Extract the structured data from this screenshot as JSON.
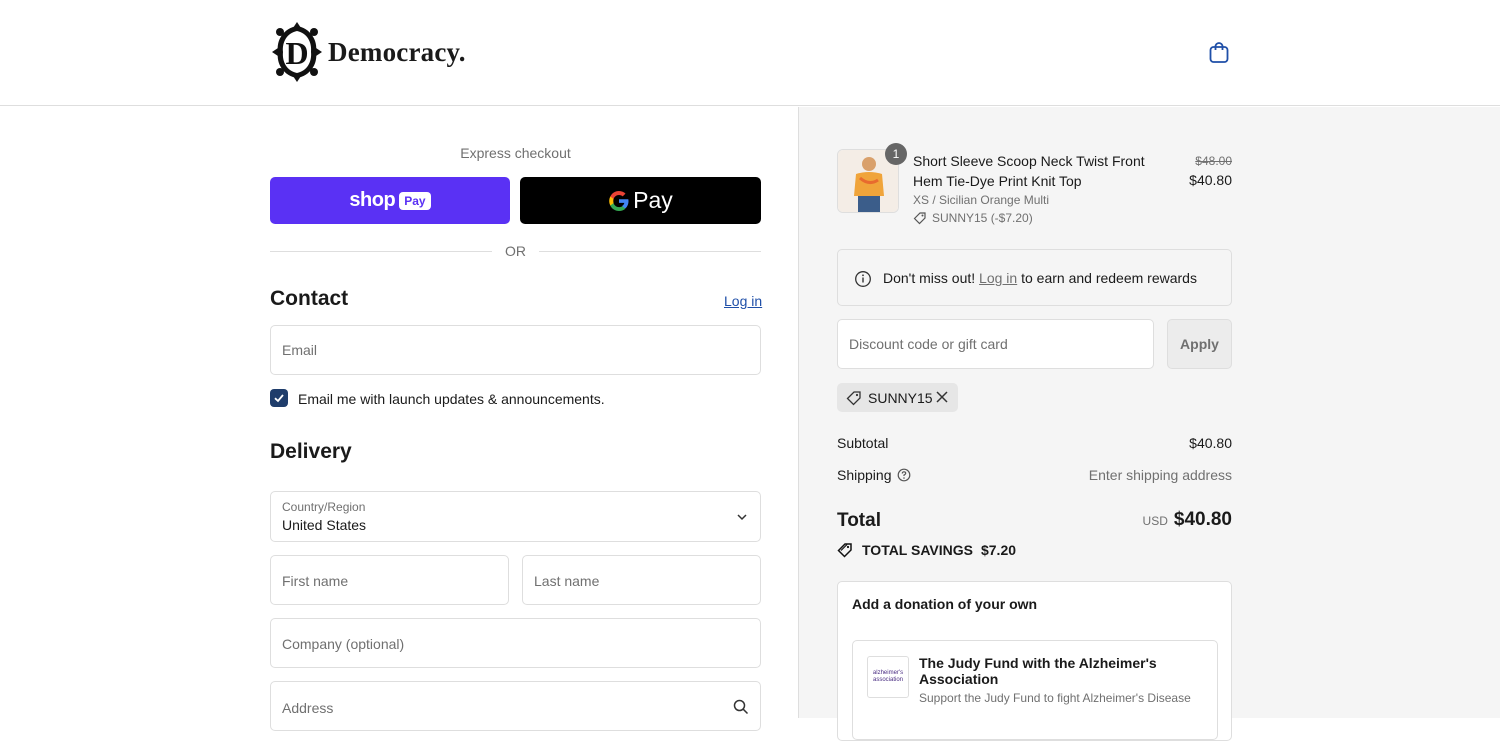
{
  "brand": {
    "name": "Democracy.",
    "logo_icon": "damask-d-monogram",
    "cart_icon": "shopping-bag-icon"
  },
  "express": {
    "label": "Express checkout",
    "shop_pay": {
      "word": "shop",
      "badge": "Pay"
    },
    "gpay": {
      "g": "G",
      "word": "Pay"
    },
    "or": "OR"
  },
  "contact": {
    "heading": "Contact",
    "login": "Log in",
    "email_placeholder": "Email",
    "newsletter_label": "Email me with launch updates & announcements.",
    "newsletter_checked": true
  },
  "delivery": {
    "heading": "Delivery",
    "country_label": "Country/Region",
    "country_value": "United States",
    "first_name": "First name",
    "last_name": "Last name",
    "company": "Company (optional)",
    "address": "Address"
  },
  "summary": {
    "item": {
      "qty": "1",
      "name": "Short Sleeve Scoop Neck Twist Front Hem Tie-Dye Print Knit Top",
      "variant": "XS / Sicilian Orange Multi",
      "discount": "SUNNY15 (-$7.20)",
      "original_price": "$48.00",
      "price": "$40.80"
    },
    "rewards": {
      "before": "Don't miss out! ",
      "link": "Log in",
      "after": " to earn and redeem rewards"
    },
    "discount_placeholder": "Discount code or gift card",
    "apply": "Apply",
    "applied_code": "SUNNY15",
    "subtotal_label": "Subtotal",
    "subtotal_value": "$40.80",
    "shipping_label": "Shipping",
    "shipping_value": "Enter shipping address",
    "total_label": "Total",
    "currency": "USD",
    "total_value": "$40.80",
    "savings_label": "TOTAL SAVINGS",
    "savings_value": "$7.20",
    "donation_title": "Add a donation of your own",
    "org_logo_text": "alzheimer's association",
    "org_name": "The Judy Fund with the Alzheimer's Association",
    "org_desc": "Support the Judy Fund to fight Alzheimer's Disease"
  },
  "colors": {
    "shop_pay": "#5a31f4",
    "gpay": "#000000",
    "link": "#1f4fa8",
    "checkbox": "#1f3d6b",
    "summary_bg": "#f5f5f5"
  }
}
